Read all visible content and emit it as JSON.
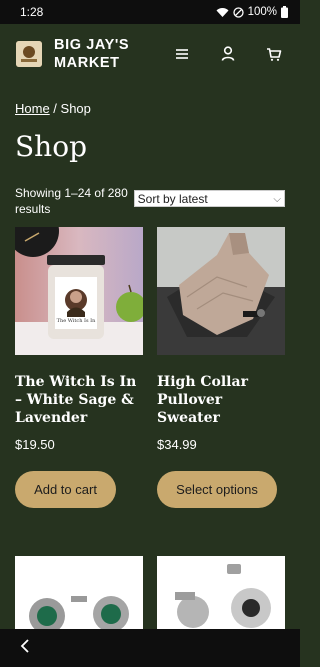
{
  "status_bar": {
    "time": "1:28",
    "battery": "100%"
  },
  "header": {
    "site_title": "BIG JAY'S MARKET",
    "logo_text": "BIG JAY'S",
    "icons": [
      "menu-icon",
      "account-icon",
      "cart-icon"
    ]
  },
  "breadcrumb": {
    "home": "Home",
    "separator": " / ",
    "current": "Shop"
  },
  "page_title": "Shop",
  "results": {
    "count_text": "Showing 1–24 of 280 results",
    "sort_selected": "Sort by latest"
  },
  "products": [
    {
      "title": "The Witch Is In – White Sage & Lavender",
      "price": "$19.50",
      "button": "Add to cart",
      "label_text": "The Witch Is In"
    },
    {
      "title": "High Collar Pullover Sweater",
      "price": "$34.99",
      "button": "Select options"
    }
  ],
  "colors": {
    "background": "#26331f",
    "button": "#c9a96e",
    "status_bar": "#0e0e0e"
  }
}
